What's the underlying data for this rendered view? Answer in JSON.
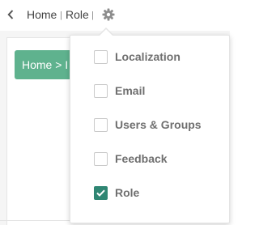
{
  "breadcrumb": {
    "home": "Home",
    "separator": "|",
    "current": "Role"
  },
  "content": {
    "header_text": "Home > I"
  },
  "dropdown": {
    "options": [
      {
        "label": "Localization",
        "checked": false
      },
      {
        "label": "Email",
        "checked": false
      },
      {
        "label": "Users & Groups",
        "checked": false
      },
      {
        "label": "Feedback",
        "checked": false
      },
      {
        "label": "Role",
        "checked": true
      }
    ]
  },
  "icons": {
    "back": "chevron-left-icon",
    "settings": "gear-icon",
    "check": "checkmark-icon"
  },
  "colors": {
    "accent_green": "#5fb28e",
    "checkbox_checked": "#2f8673",
    "option_text": "#6f6f6f"
  }
}
